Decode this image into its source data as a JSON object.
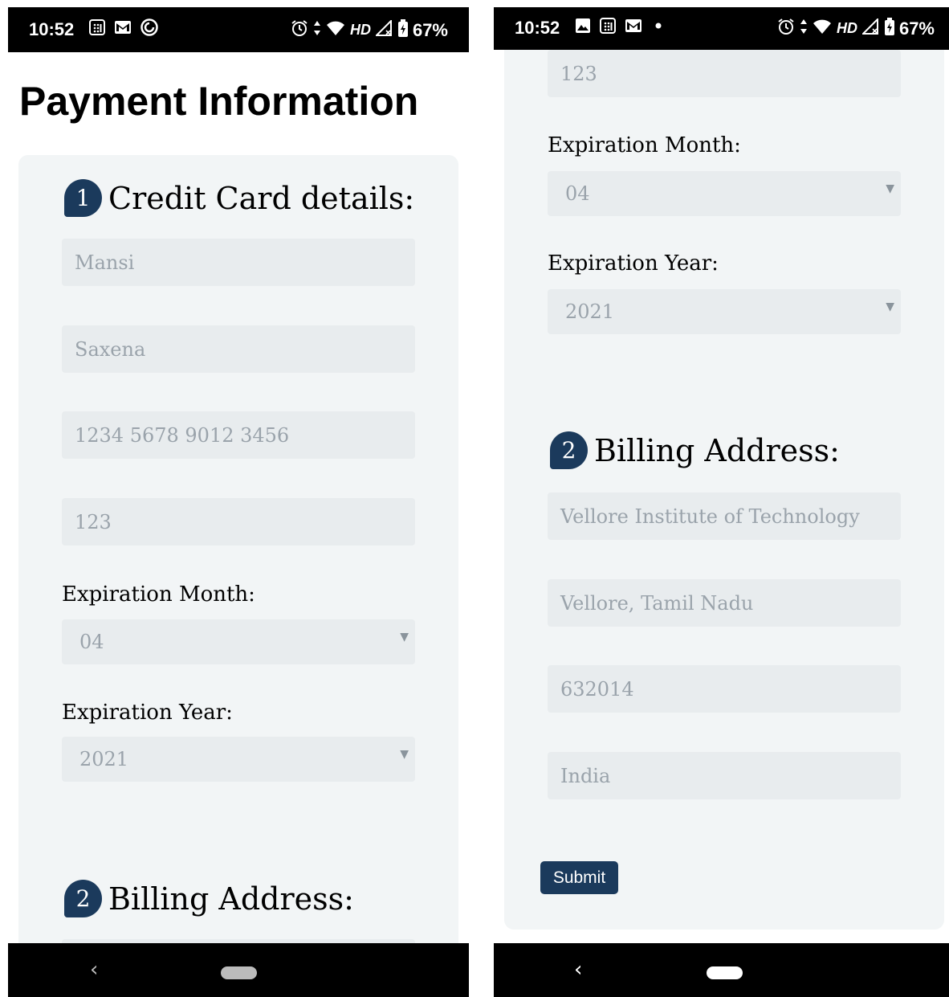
{
  "status_bar": {
    "time": "10:52",
    "hd": "HD",
    "battery": "67%"
  },
  "page": {
    "title": "Payment Information"
  },
  "credit_card": {
    "step": "1",
    "heading": "Credit Card details:",
    "first_name": "Mansi",
    "last_name": "Saxena",
    "card_number": "1234 5678 9012 3456",
    "cvv": "123",
    "exp_month_label": "Expiration Month:",
    "exp_month": "04",
    "exp_year_label": "Expiration Year:",
    "exp_year": "2021"
  },
  "billing": {
    "step": "2",
    "heading": "Billing Address:",
    "address": "Vellore Institute of Technology",
    "city": "Vellore, Tamil Nadu",
    "zip": "632014",
    "country": "India"
  },
  "actions": {
    "submit": "Submit"
  },
  "colors": {
    "accent": "#1b3a5c",
    "card_bg": "#f2f5f6",
    "field_bg": "#e8ecee",
    "placeholder_text": "#9aa3ab"
  }
}
